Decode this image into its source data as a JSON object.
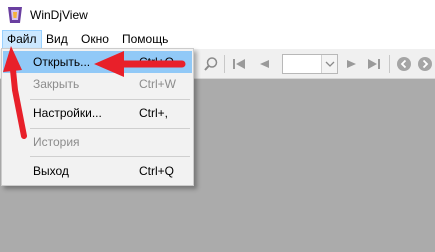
{
  "window": {
    "title": "WinDjView"
  },
  "menubar": {
    "items": [
      {
        "label": "Файл"
      },
      {
        "label": "Вид"
      },
      {
        "label": "Окно"
      },
      {
        "label": "Помощь"
      }
    ]
  },
  "file_menu": {
    "items": [
      {
        "label": "Открыть...",
        "shortcut": "Ctrl+O",
        "state": "highlighted"
      },
      {
        "label": "Закрыть",
        "shortcut": "Ctrl+W",
        "state": "disabled"
      },
      {
        "label": "Настройки...",
        "shortcut": "Ctrl+,",
        "state": "enabled"
      },
      {
        "label": "История",
        "shortcut": "",
        "state": "disabled"
      },
      {
        "label": "Выход",
        "shortcut": "Ctrl+Q",
        "state": "enabled"
      }
    ]
  },
  "toolbar": {
    "icons": [
      "zoom-icon",
      "first-page-icon",
      "previous-page-icon",
      "page-number-select",
      "next-page-icon",
      "last-page-icon",
      "back-icon",
      "forward-icon"
    ]
  },
  "annotations": {
    "arrow_color": "#e8202a"
  },
  "colors": {
    "menu_highlight": "#91c9f7",
    "content_bg": "#ababab"
  }
}
